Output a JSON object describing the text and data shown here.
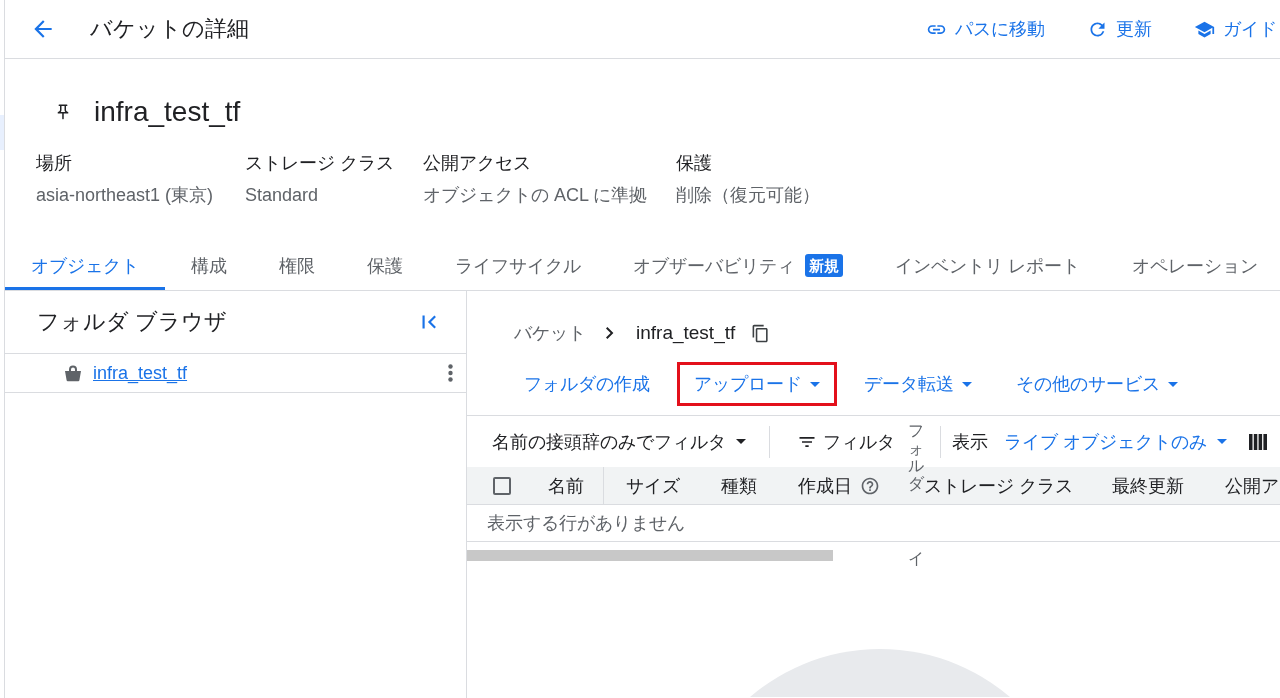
{
  "header": {
    "title": "バケットの詳細",
    "actions": [
      {
        "kind": "link",
        "label": "パスに移動"
      },
      {
        "kind": "refresh",
        "label": "更新"
      },
      {
        "kind": "guide",
        "label": "ガイド"
      }
    ]
  },
  "bucket": {
    "name": "infra_test_tf",
    "properties": [
      {
        "label": "場所",
        "value": "asia-northeast1 (東京)"
      },
      {
        "label": "ストレージ クラス",
        "value": "Standard"
      },
      {
        "label": "公開アクセス",
        "value": "オブジェクトの ACL に準拠"
      },
      {
        "label": "保護",
        "value": "削除（復元可能）"
      }
    ]
  },
  "tabs": [
    {
      "label": "オブジェクト",
      "selected": true
    },
    {
      "label": "構成",
      "selected": false
    },
    {
      "label": "権限",
      "selected": false
    },
    {
      "label": "保護",
      "selected": false
    },
    {
      "label": "ライフサイクル",
      "selected": false
    },
    {
      "label": "オブザーバビリティ",
      "selected": false,
      "badge": "新規"
    },
    {
      "label": "インベントリ レポート",
      "selected": false
    },
    {
      "label": "オペレーション",
      "selected": false
    }
  ],
  "folder_browser": {
    "title": "フォルダ ブラウザ",
    "items": [
      {
        "name": "infra_test_tf"
      }
    ]
  },
  "breadcrumb": [
    "バケット",
    "infra_test_tf"
  ],
  "actions": [
    {
      "label": "フォルダの作成",
      "dropdown": false,
      "highlighted": false
    },
    {
      "label": "アップロード",
      "dropdown": true,
      "highlighted": true
    },
    {
      "label": "データ転送",
      "dropdown": true,
      "highlighted": false
    },
    {
      "label": "その他のサービス",
      "dropdown": true,
      "highlighted": false
    }
  ],
  "filter_bar": {
    "prefix_filter": "名前の接頭辞のみでフィルタ",
    "filter": "フィルタ",
    "view_label": "表示",
    "view_value": "ライブ オブジェクトのみ"
  },
  "table": {
    "select_all_checked": false,
    "columns": [
      {
        "label": "名前",
        "help": false
      },
      {
        "label": "サイズ",
        "help": false
      },
      {
        "label": "種類",
        "help": false
      },
      {
        "label": "作成日",
        "help": true
      },
      {
        "label": "ストレージ クラス",
        "help": false
      },
      {
        "label": "最終更新",
        "help": false
      },
      {
        "label": "公開ア",
        "help": false
      }
    ],
    "empty_message": "表示する行がありません"
  },
  "vertical_labels": [
    {
      "text": "フォルダ"
    },
    {
      "text": "イ"
    }
  ]
}
